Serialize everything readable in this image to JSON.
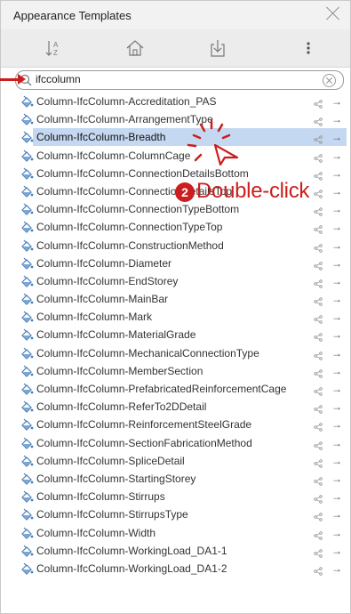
{
  "panel": {
    "title": "Appearance Templates",
    "close_icon": "close-icon"
  },
  "toolbar": {
    "sort_icon": "sort-az-icon",
    "home_icon": "home-icon",
    "import_icon": "import-icon",
    "more_icon": "more-vertical-icon"
  },
  "search": {
    "value": "ifccolumn",
    "placeholder": "",
    "clear_icon": "clear-circle-icon"
  },
  "items": [
    {
      "label": "Column-IfcColumn-Accreditation_PAS"
    },
    {
      "label": "Column-IfcColumn-ArrangementType"
    },
    {
      "label": "Column-IfcColumn-Breadth",
      "selected": true
    },
    {
      "label": "Column-IfcColumn-ColumnCage"
    },
    {
      "label": "Column-IfcColumn-ConnectionDetailsBottom"
    },
    {
      "label": "Column-IfcColumn-ConnectionDetailsTop"
    },
    {
      "label": "Column-IfcColumn-ConnectionTypeBottom"
    },
    {
      "label": "Column-IfcColumn-ConnectionTypeTop"
    },
    {
      "label": "Column-IfcColumn-ConstructionMethod"
    },
    {
      "label": "Column-IfcColumn-Diameter"
    },
    {
      "label": "Column-IfcColumn-EndStorey"
    },
    {
      "label": "Column-IfcColumn-MainBar"
    },
    {
      "label": "Column-IfcColumn-Mark"
    },
    {
      "label": "Column-IfcColumn-MaterialGrade"
    },
    {
      "label": "Column-IfcColumn-MechanicalConnectionType"
    },
    {
      "label": "Column-IfcColumn-MemberSection"
    },
    {
      "label": "Column-IfcColumn-PrefabricatedReinforcementCage"
    },
    {
      "label": "Column-IfcColumn-ReferTo2DDetail"
    },
    {
      "label": "Column-IfcColumn-ReinforcementSteelGrade"
    },
    {
      "label": "Column-IfcColumn-SectionFabricationMethod"
    },
    {
      "label": "Column-IfcColumn-SpliceDetail"
    },
    {
      "label": "Column-IfcColumn-StartingStorey"
    },
    {
      "label": "Column-IfcColumn-Stirrups"
    },
    {
      "label": "Column-IfcColumn-StirrupsType"
    },
    {
      "label": "Column-IfcColumn-Width"
    },
    {
      "label": "Column-IfcColumn-WorkingLoad_DA1-1"
    },
    {
      "label": "Column-IfcColumn-WorkingLoad_DA1-2"
    }
  ],
  "row_icons": {
    "item_icon": "paint-bucket-icon",
    "share_icon": "share-icon",
    "go_icon": "arrow-right-icon",
    "go_glyph": "→"
  },
  "annotation": {
    "step_number": "2",
    "callout_text": "Double-click",
    "accent_color": "#cc1e1e"
  },
  "colors": {
    "selected_row": "#c5d8f1",
    "toolbar_bg": "#ececec",
    "titlebar_bg": "#f2f2f2"
  }
}
